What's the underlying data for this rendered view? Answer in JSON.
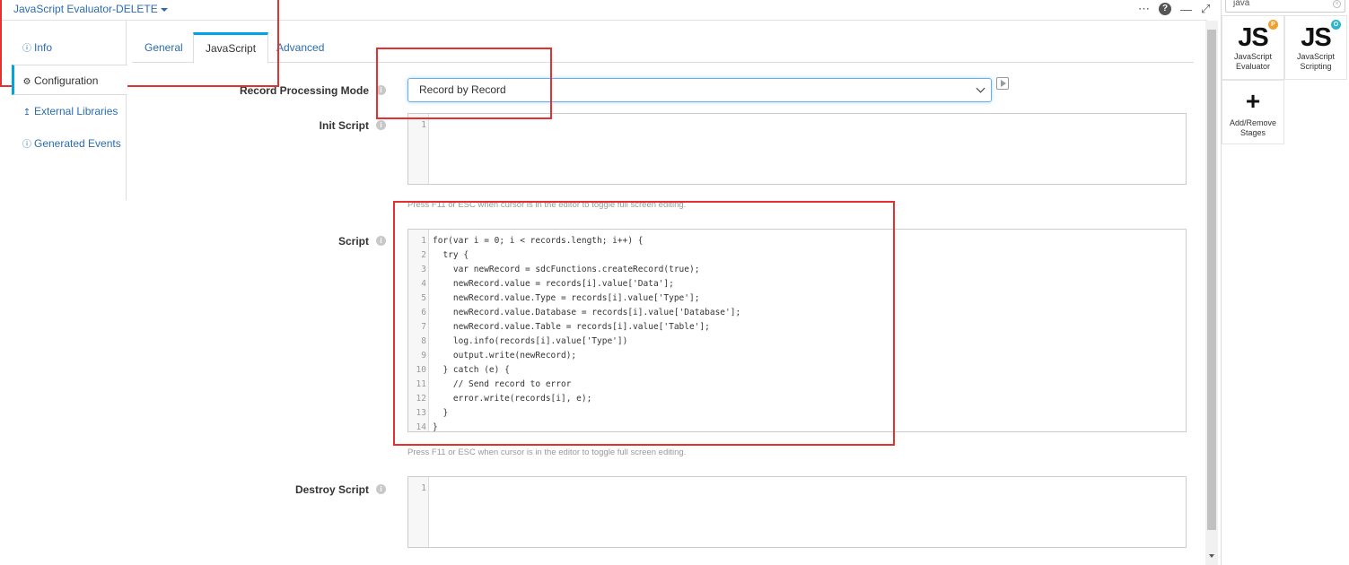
{
  "header": {
    "stage_title": "JavaScript Evaluator-DELETE",
    "icons": [
      "more-icon",
      "help-icon",
      "minimize-icon",
      "expand-icon"
    ]
  },
  "leftnav": {
    "items": [
      {
        "label": "Info",
        "icon": "info-icon"
      },
      {
        "label": "Configuration",
        "icon": "gear-icon"
      },
      {
        "label": "External Libraries",
        "icon": "upload-icon"
      },
      {
        "label": "Generated Events",
        "icon": "info-icon"
      }
    ]
  },
  "tabs": [
    "General",
    "JavaScript",
    "Advanced"
  ],
  "fields": {
    "record_processing_mode": {
      "label": "Record Processing Mode",
      "value": "Record by Record"
    },
    "init_script": {
      "label": "Init Script",
      "line_numbers": [
        "1"
      ]
    },
    "script": {
      "label": "Script"
    },
    "destroy_script": {
      "label": "Destroy Script",
      "line_numbers": [
        "1"
      ]
    }
  },
  "editor_hint": "Press F11 or ESC when cursor is in the editor to toggle full screen editing.",
  "script_lines": [
    {
      "n": "1",
      "text": "for(var i = 0; i < records.length; i++) {"
    },
    {
      "n": "2",
      "text": "  try {"
    },
    {
      "n": "3",
      "text": "    var newRecord = sdcFunctions.createRecord(true);"
    },
    {
      "n": "4",
      "text": "    newRecord.value = records[i].value['Data'];"
    },
    {
      "n": "5",
      "text": "    newRecord.value.Type = records[i].value['Type'];"
    },
    {
      "n": "6",
      "text": "    newRecord.value.Database = records[i].value['Database'];"
    },
    {
      "n": "7",
      "text": "    newRecord.value.Table = records[i].value['Table'];"
    },
    {
      "n": "8",
      "text": "    log.info(records[i].value['Type'])"
    },
    {
      "n": "9",
      "text": "    output.write(newRecord);"
    },
    {
      "n": "10",
      "text": "  } catch (e) {"
    },
    {
      "n": "11",
      "text": "    // Send record to error"
    },
    {
      "n": "12",
      "text": "    error.write(records[i], e);"
    },
    {
      "n": "13",
      "text": "  }"
    },
    {
      "n": "14",
      "text": "}"
    }
  ],
  "library": {
    "search_value": "java",
    "cards": [
      {
        "logo": "JS",
        "label": "JavaScript Evaluator",
        "badge": "P",
        "badge_color": "#f0a030"
      },
      {
        "logo": "JS",
        "label": "JavaScript Scripting",
        "badge": "O",
        "badge_color": "#2bb4d4"
      },
      {
        "logo": "+",
        "label": "Add/Remove Stages"
      }
    ]
  },
  "colors": {
    "accent": "#00a4e4",
    "link": "#2b6cb0",
    "annotation": "#e53030"
  }
}
